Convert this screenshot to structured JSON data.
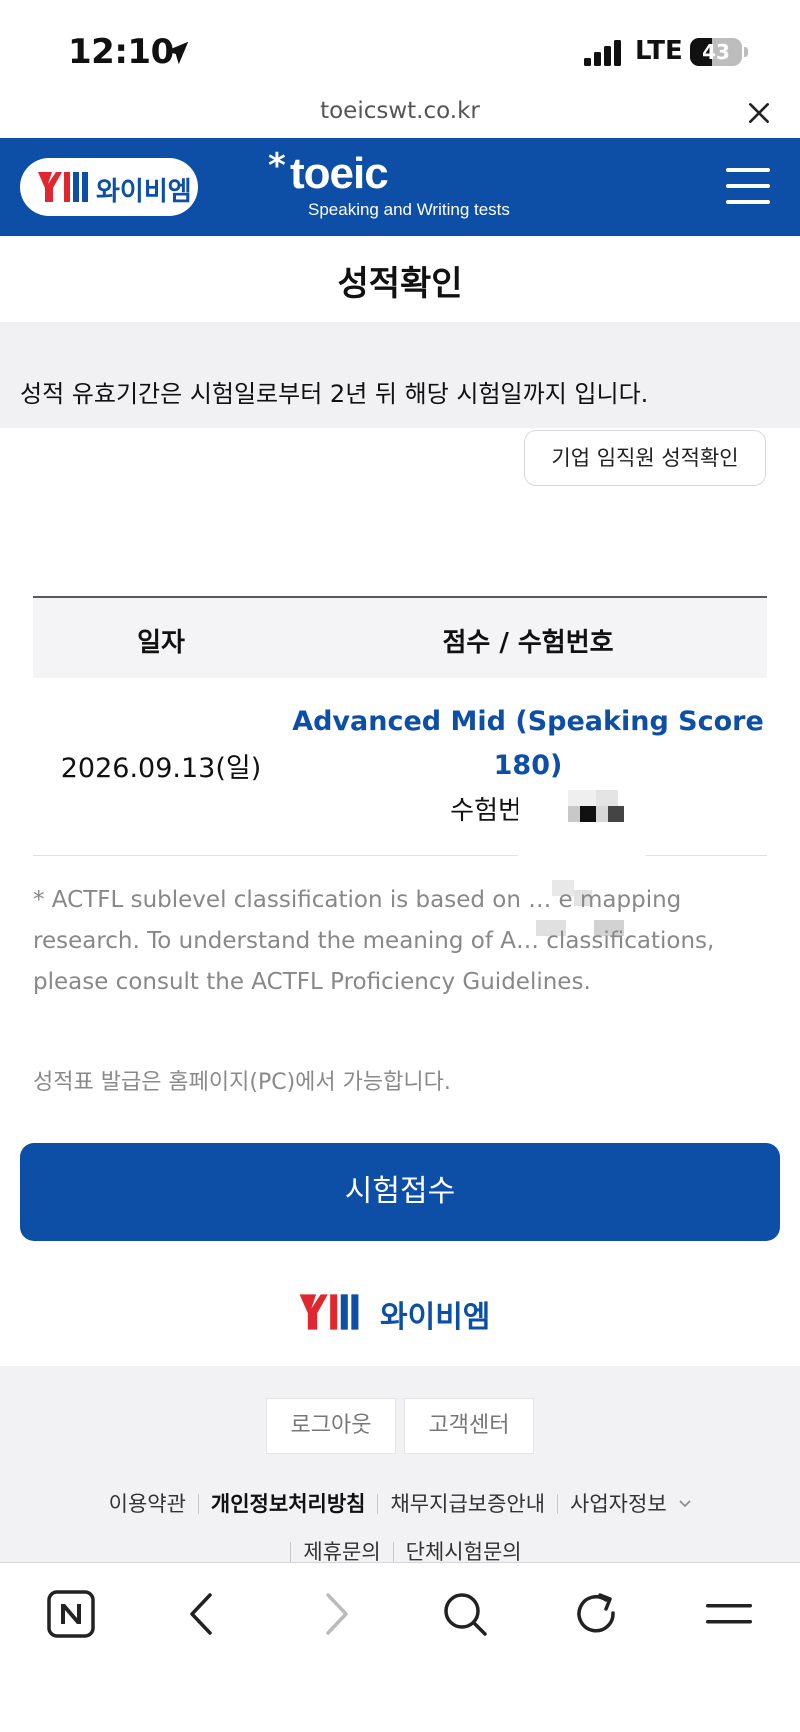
{
  "status_bar": {
    "time": "12:10",
    "network": "LTE",
    "battery": "43",
    "battery_level": 0.43
  },
  "browser": {
    "url": "toeicswt.co.kr"
  },
  "header": {
    "ybm_text": "와이비엠",
    "toeic_text": "toeic",
    "toeic_subtitle": "Speaking and Writing tests"
  },
  "page": {
    "title": "성적확인"
  },
  "notice": {
    "text": "성적 유효기간은 시험일로부터 2년 뒤 해당 시험일까지 입니다."
  },
  "corporate_button": {
    "label": "기업 임직원 성적확인"
  },
  "table": {
    "headers": [
      "일자",
      "점수 / 수험번호"
    ],
    "rows": [
      {
        "date": "2026.09.13(일)",
        "score": "Advanced Mid (Speaking Score 180)",
        "exam_number_label": "수험번호"
      }
    ]
  },
  "footnote": "* ACTFL sublevel classification is based on … e mapping research. To understand the meaning of A… classifications, please consult the ACTFL Proficiency Guidelines.",
  "issue_note": "성적표 발급은 홈페이지(PC)에서 가능합니다.",
  "apply_button": {
    "label": "시험접수"
  },
  "bottom_logo": {
    "text": "와이비엠"
  },
  "footer": {
    "buttons": [
      "로그아웃",
      "고객센터"
    ],
    "links_row1": [
      "이용약관",
      "개인정보처리방침",
      "채무지급보증안내",
      "사업자정보"
    ],
    "links_row2": [
      "제휴문의",
      "단체시험문의"
    ]
  },
  "toolbar_icons": [
    "naver-n-icon",
    "back-icon",
    "forward-icon",
    "search-icon",
    "refresh-icon",
    "menu-icon"
  ],
  "colors": {
    "brand_blue": "#0d4ea6",
    "ybm_red": "#e0262f"
  }
}
